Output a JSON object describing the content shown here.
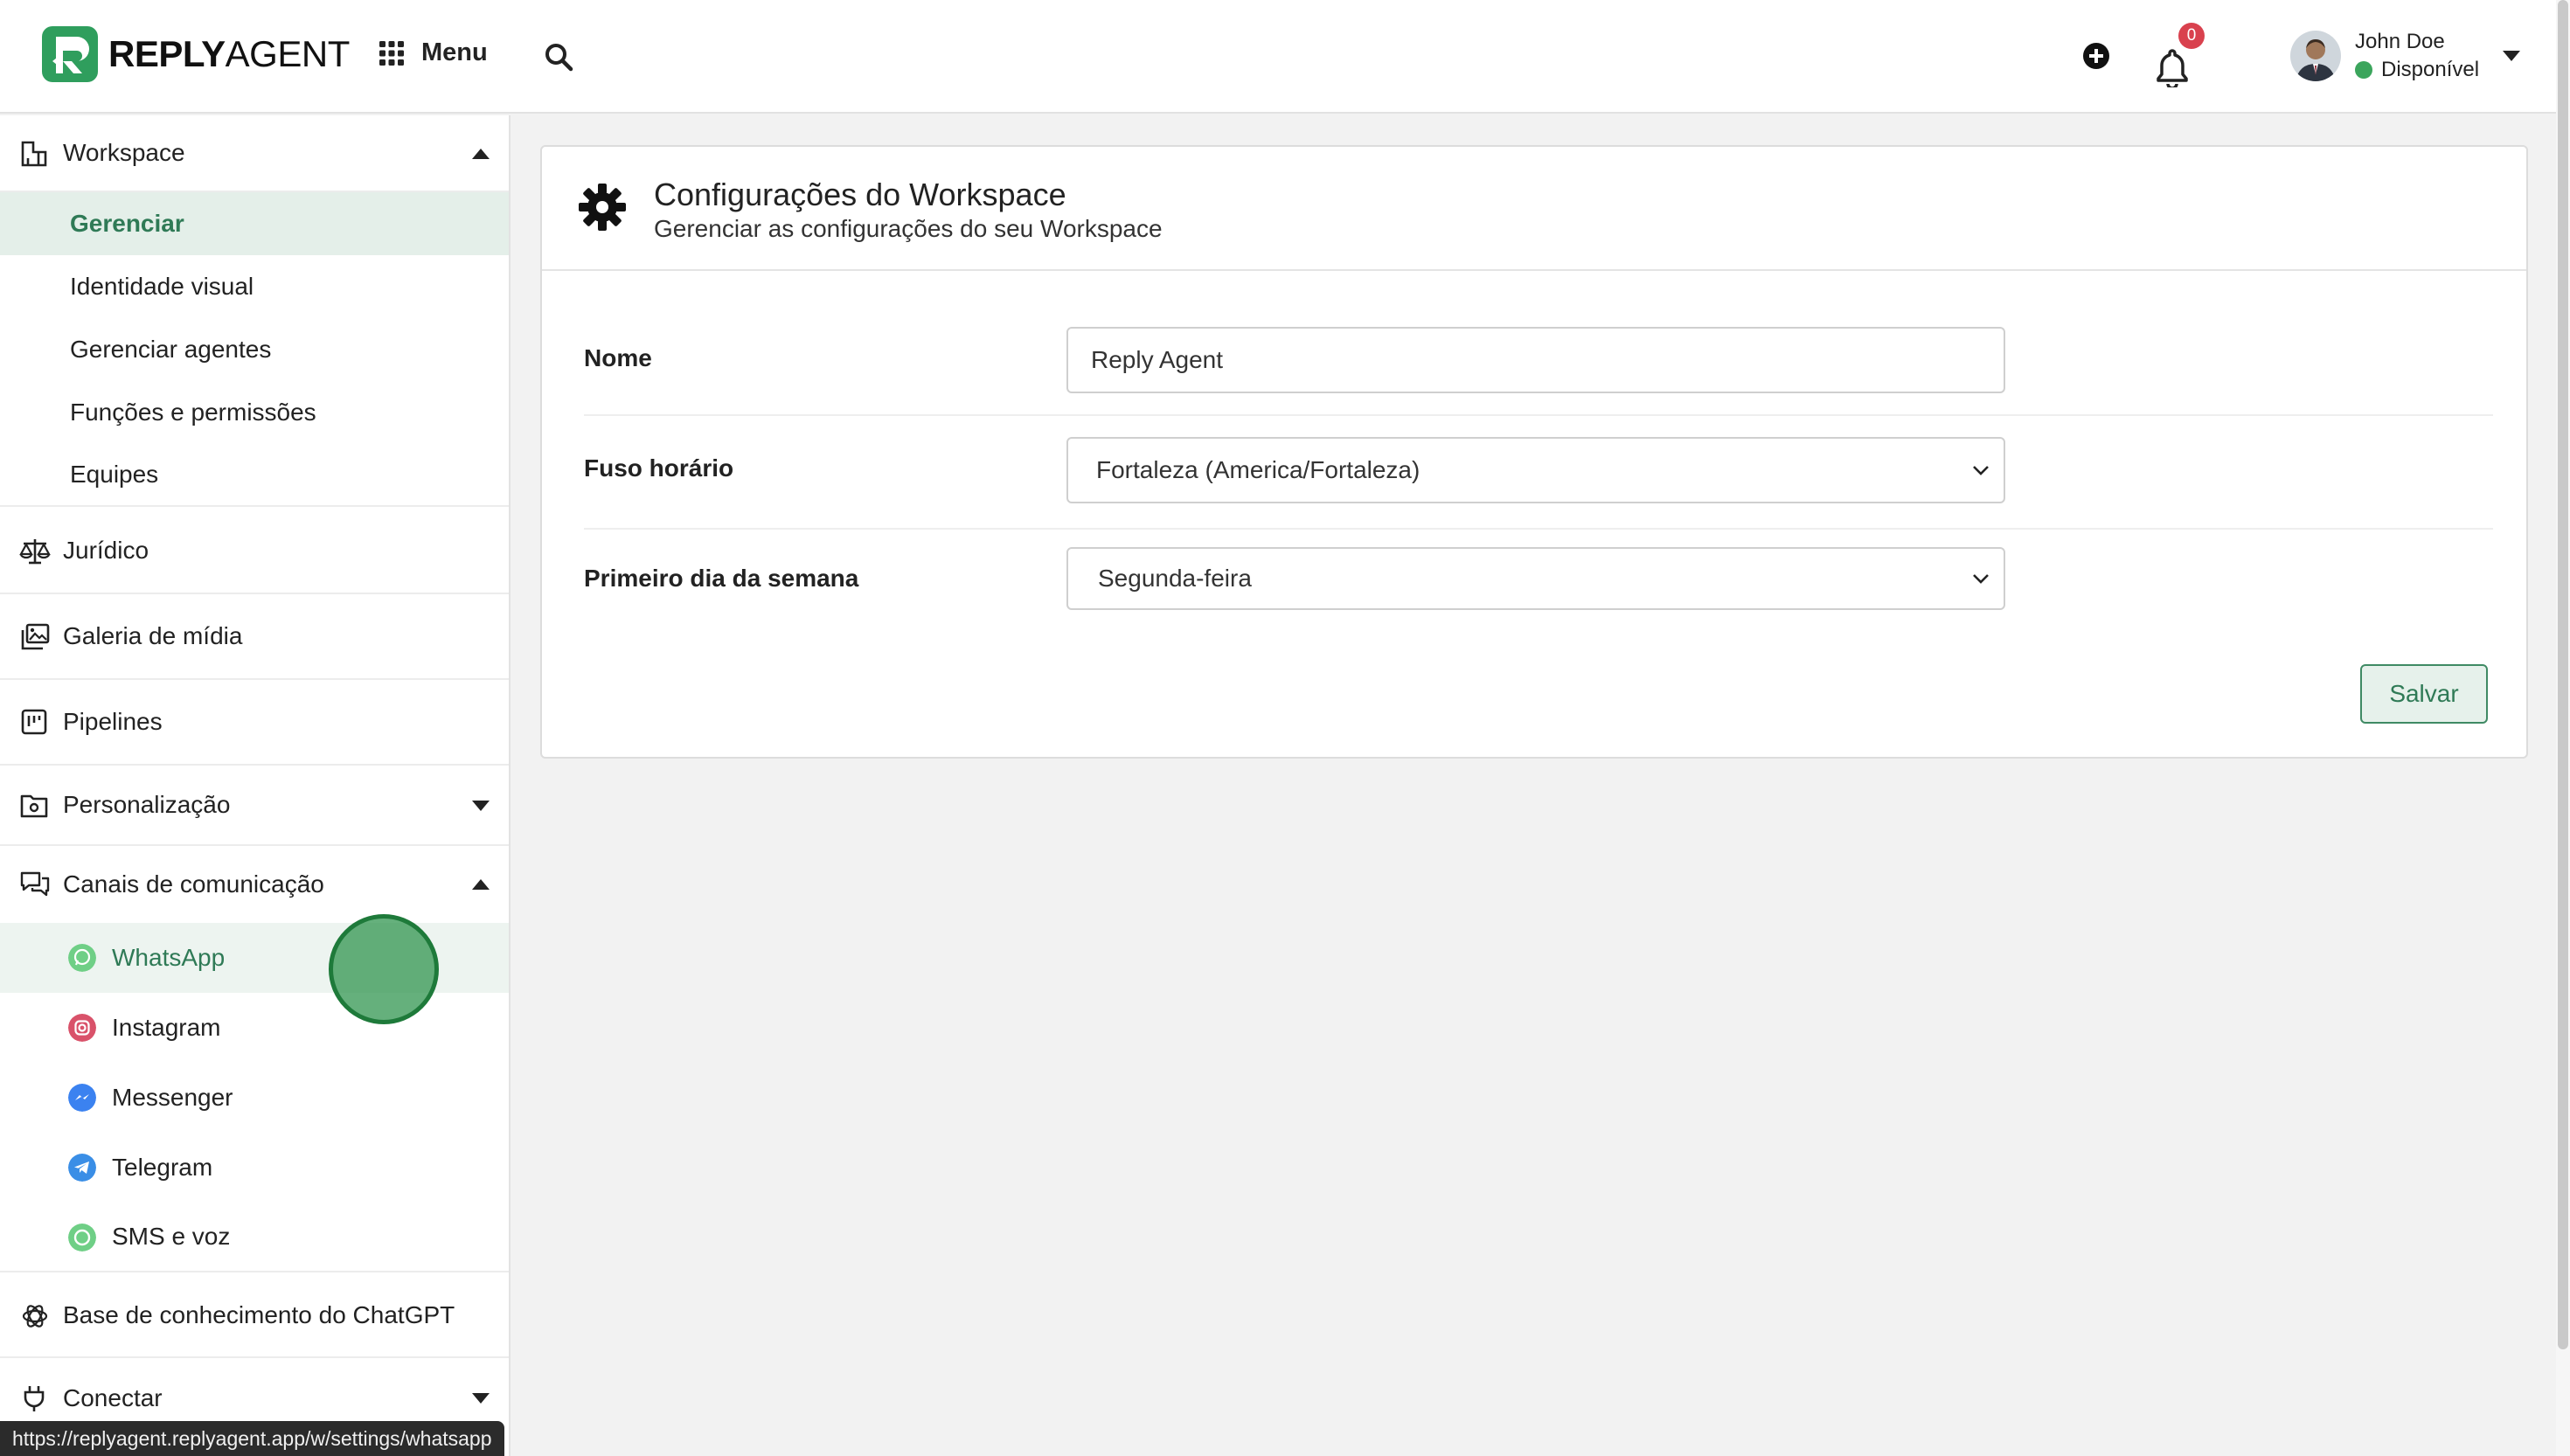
{
  "app": {
    "logo_text_bold": "REPLY",
    "logo_text_light": "AGENT",
    "brand_color": "#2f9e5d"
  },
  "topbar": {
    "menu_label": "Menu",
    "notification_count": "0",
    "user": {
      "name": "John Doe",
      "status": "Disponível",
      "status_color": "#3ba55c"
    }
  },
  "sidebar": {
    "workspace": {
      "label": "Workspace",
      "items": [
        {
          "label": "Gerenciar",
          "active": true
        },
        {
          "label": "Identidade visual"
        },
        {
          "label": "Gerenciar agentes"
        },
        {
          "label": "Funções e permissões"
        },
        {
          "label": "Equipes"
        }
      ]
    },
    "juridico": "Jurídico",
    "galeria": "Galeria de mídia",
    "pipelines": "Pipelines",
    "personalizacao": "Personalização",
    "canais": {
      "label": "Canais de comunicação",
      "items": [
        {
          "label": "WhatsApp",
          "icon": "whatsapp-icon",
          "color": "#6fcf86",
          "active": true
        },
        {
          "label": "Instagram",
          "icon": "instagram-icon",
          "color": "#d9526a"
        },
        {
          "label": "Messenger",
          "icon": "messenger-icon",
          "color": "#3b82f0"
        },
        {
          "label": "Telegram",
          "icon": "telegram-icon",
          "color": "#3a8ee6"
        },
        {
          "label": "SMS e voz",
          "icon": "sms-icon",
          "color": "#6fcf86"
        }
      ]
    },
    "chatgpt": "Base de conhecimento do ChatGPT",
    "conectar": "Conectar"
  },
  "status_url": "https://replyagent.replyagent.app/w/settings/whatsapp",
  "main": {
    "title": "Configurações do Workspace",
    "subtitle": "Gerenciar as configurações do seu Workspace",
    "fields": {
      "nome_label": "Nome",
      "nome_value": "Reply Agent",
      "fuso_label": "Fuso horário",
      "fuso_value": "Fortaleza (America/Fortaleza)",
      "dia_label": "Primeiro dia da semana",
      "dia_value": "Segunda-feira"
    },
    "save_label": "Salvar"
  }
}
